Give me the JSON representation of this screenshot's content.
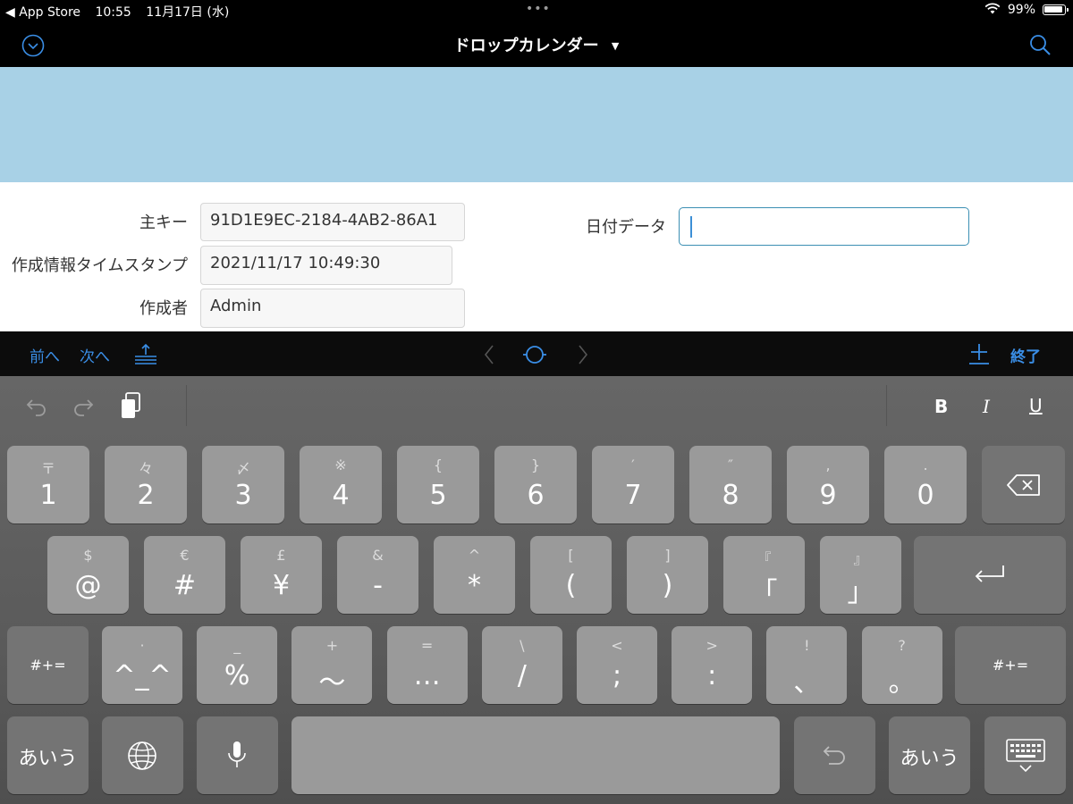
{
  "status_bar": {
    "back_app": "◀ App Store",
    "time": "10:55",
    "date": "11月17日 (水)",
    "battery": "99%"
  },
  "nav": {
    "title": "ドロップカレンダー",
    "accent_color": "#3a8ee6"
  },
  "header": {
    "color": "#a8d1e6"
  },
  "form": {
    "primary_key_label": "主キー",
    "primary_key_value": "91D1E9EC-2184-4AB2-86A1",
    "timestamp_label": "作成情報タイムスタンプ",
    "timestamp_value": "2021/11/17 10:49:30",
    "creator_label": "作成者",
    "creator_value": "Admin",
    "date_label": "日付データ",
    "date_value": ""
  },
  "accessory": {
    "prev": "前へ",
    "next": "次へ",
    "done": "終了"
  },
  "keyboard": {
    "format_bold": "B",
    "format_italic": "I",
    "format_underline": "U",
    "row1": [
      {
        "sub": "〒",
        "main": "1"
      },
      {
        "sub": "々",
        "main": "2"
      },
      {
        "sub": "〆",
        "main": "3"
      },
      {
        "sub": "※",
        "main": "4"
      },
      {
        "sub": "{",
        "main": "5"
      },
      {
        "sub": "}",
        "main": "6"
      },
      {
        "sub": "′",
        "main": "7"
      },
      {
        "sub": "″",
        "main": "8"
      },
      {
        "sub": ",",
        "main": "9"
      },
      {
        "sub": ".",
        "main": "0"
      }
    ],
    "row2": [
      {
        "sub": "$",
        "main": "@"
      },
      {
        "sub": "€",
        "main": "#"
      },
      {
        "sub": "£",
        "main": "¥"
      },
      {
        "sub": "&",
        "main": "-"
      },
      {
        "sub": "^",
        "main": "*"
      },
      {
        "sub": "[",
        "main": "("
      },
      {
        "sub": "]",
        "main": ")"
      },
      {
        "sub": "『",
        "main": "「"
      },
      {
        "sub": "』",
        "main": "」"
      }
    ],
    "row3": [
      {
        "sub": "·",
        "main": "^_^"
      },
      {
        "sub": "_",
        "main": "%"
      },
      {
        "sub": "+",
        "main": "〜"
      },
      {
        "sub": "=",
        "main": "…"
      },
      {
        "sub": "\\",
        "main": "/"
      },
      {
        "sub": "<",
        "main": ";"
      },
      {
        "sub": ">",
        "main": ":"
      },
      {
        "sub": "!",
        "main": "、"
      },
      {
        "sub": "?",
        "main": "。"
      }
    ],
    "symbols_key": "#+=",
    "kana_key": "あいう"
  }
}
